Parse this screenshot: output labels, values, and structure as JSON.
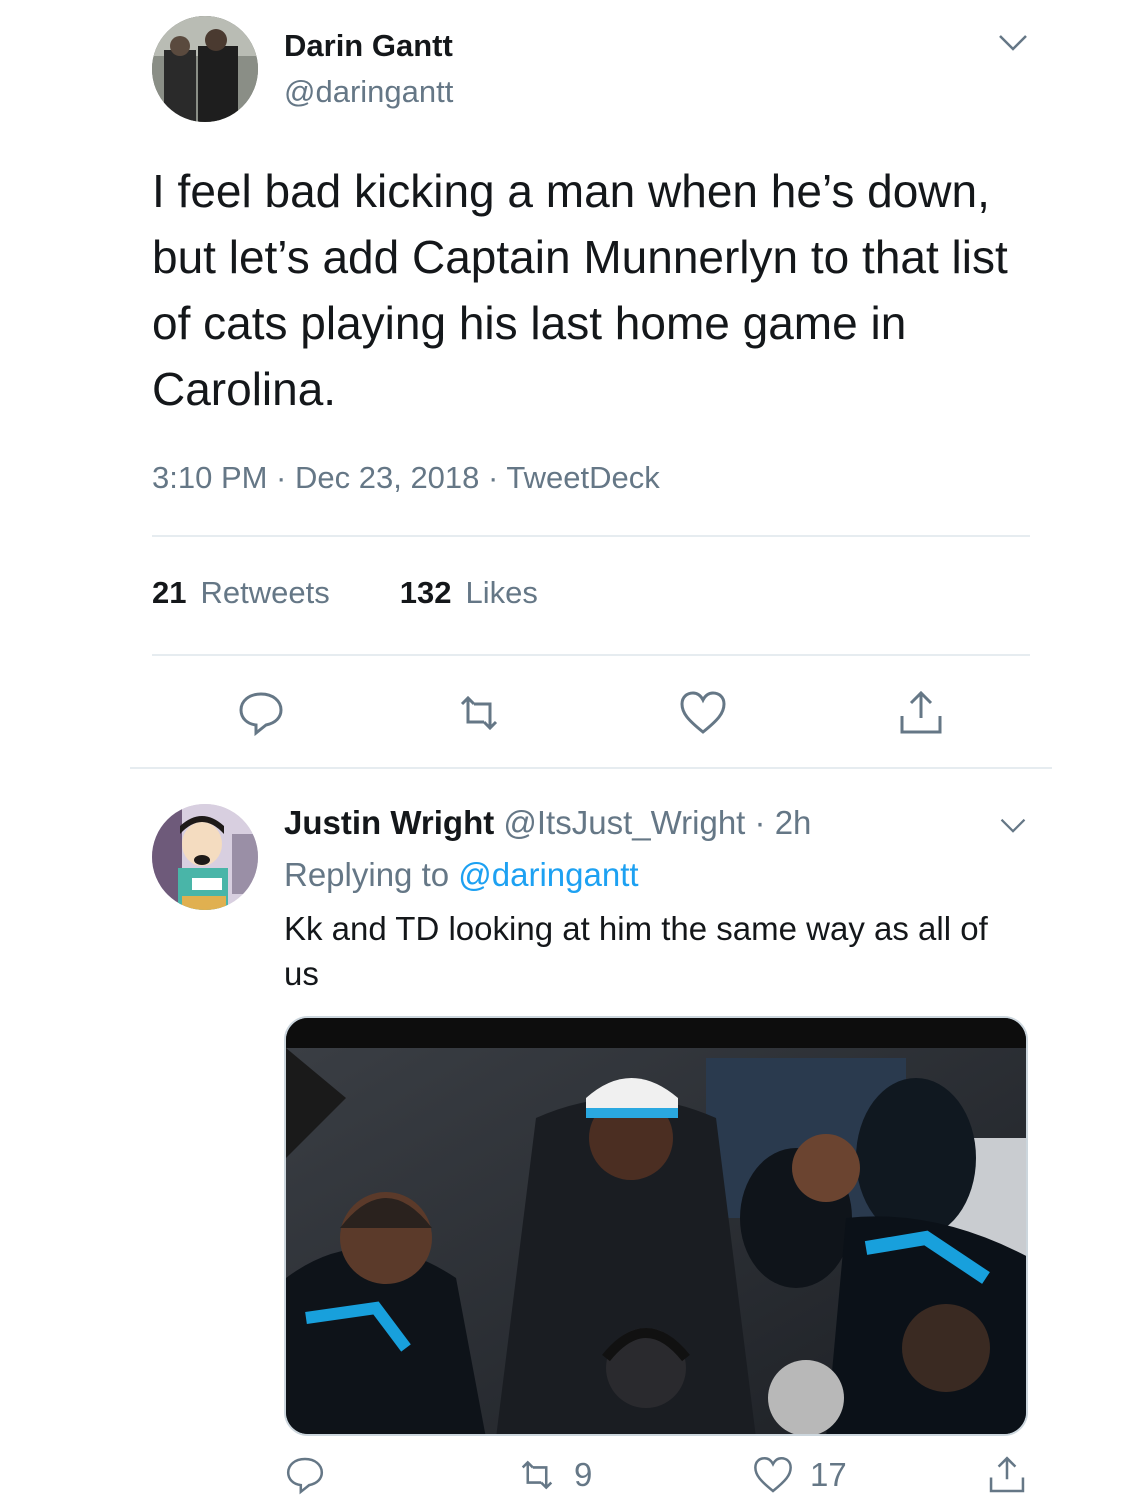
{
  "main_tweet": {
    "author_name": "Darin Gantt",
    "author_handle": "@daringantt",
    "text": "I feel bad kicking a man when he’s down, but let’s add Captain Munnerlyn to that list of cats playing his last home game in Carolina.",
    "meta": "3:10 PM · Dec 23, 2018 · TweetDeck",
    "retweets_count": "21",
    "retweets_label": "Retweets",
    "likes_count": "132",
    "likes_label": "Likes",
    "icons": [
      "reply-icon",
      "retweet-icon",
      "like-icon",
      "share-icon",
      "chevron-down-icon"
    ]
  },
  "reply": {
    "author_name": "Justin Wright",
    "author_handle": "@ItsJust_Wright",
    "time": "2h",
    "separator": "·",
    "replying_prefix": "Replying to",
    "replying_to": "@daringantt",
    "text": "Kk and TD looking at him the same way as all of us",
    "retweets_count": "9",
    "likes_count": "17",
    "media_description": "photo"
  },
  "colors": {
    "text": "#14171a",
    "secondary": "#657786",
    "link": "#1da1f2",
    "divider": "#e6ecf0"
  }
}
